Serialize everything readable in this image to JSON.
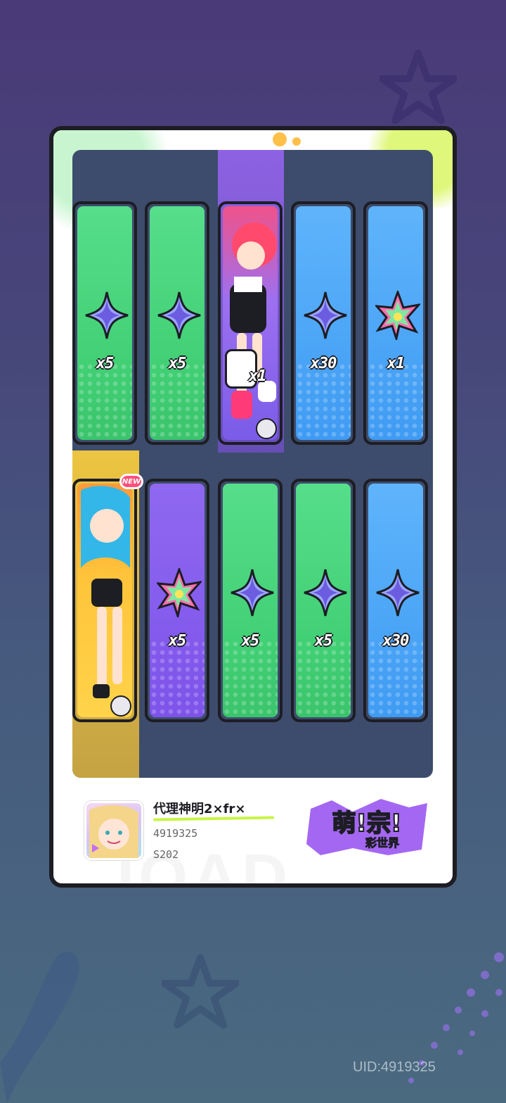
{
  "rewards": {
    "row1": [
      {
        "color": "green",
        "icon": "crystal-star-icon",
        "qty": "x5"
      },
      {
        "color": "green",
        "icon": "crystal-star-icon",
        "qty": "x5"
      },
      {
        "color": "char1",
        "icon": "character-card",
        "qty": "x1"
      },
      {
        "color": "blue",
        "icon": "crystal-star-icon",
        "qty": "x30"
      },
      {
        "color": "blue",
        "icon": "rainbow-leaf-icon",
        "qty": "x1"
      }
    ],
    "row2": [
      {
        "color": "char2",
        "icon": "character-card",
        "qty": ""
      },
      {
        "color": "purple",
        "icon": "rainbow-leaf-icon",
        "qty": "x5"
      },
      {
        "color": "green",
        "icon": "crystal-star-icon",
        "qty": "x5"
      },
      {
        "color": "green",
        "icon": "crystal-star-icon",
        "qty": "x5"
      },
      {
        "color": "blue",
        "icon": "crystal-star-icon",
        "qty": "x30"
      }
    ],
    "new_badge": "NEW"
  },
  "player": {
    "name": "代理神明2×fr×",
    "id": "4919325",
    "server": "S202"
  },
  "logo": {
    "title": "萌!宗!",
    "subtitle": "彩世界"
  },
  "uid": "UID:4919325",
  "colors": {
    "green": "#41cf74",
    "blue": "#3f9bf3",
    "purple": "#7d53ea",
    "outline": "#1d1d24"
  }
}
